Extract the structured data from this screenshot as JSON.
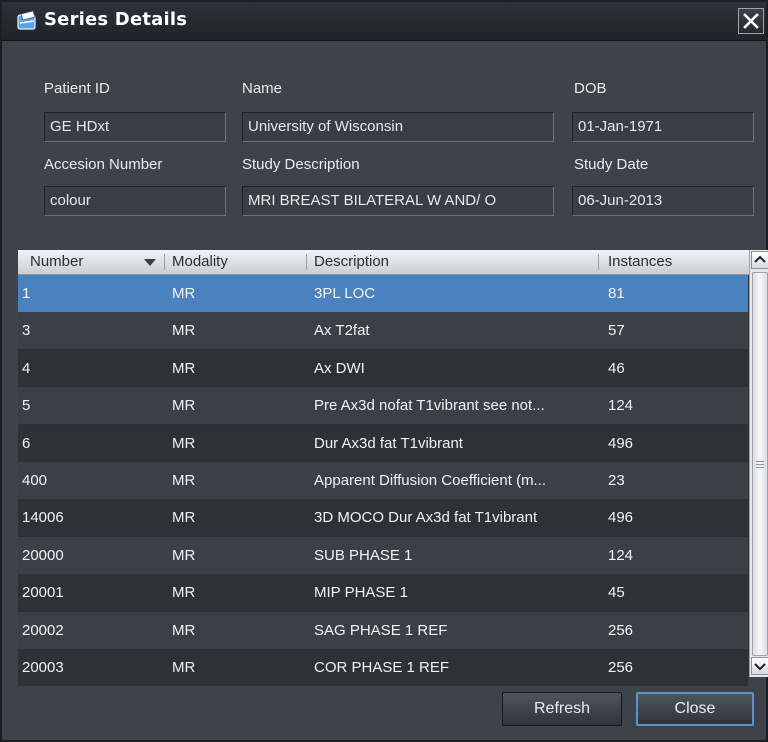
{
  "window": {
    "title": "Series Details",
    "close_glyph": "✕",
    "title_icon": "series-icon"
  },
  "form": {
    "patient_id": {
      "label": "Patient ID",
      "value": "GE HDxt"
    },
    "name": {
      "label": "Name",
      "value": "University of Wisconsin"
    },
    "dob": {
      "label": "DOB",
      "value": "01-Jan-1971"
    },
    "accession": {
      "label": "Accesion Number",
      "value": "colour"
    },
    "study_description": {
      "label": "Study Description",
      "value": "MRI BREAST BILATERAL W AND/ O"
    },
    "study_date": {
      "label": "Study Date",
      "value": "06-Jun-2013"
    }
  },
  "table": {
    "columns": [
      "Number",
      "Modality",
      "Description",
      "Instances"
    ],
    "sort_column": "Number",
    "rows": [
      {
        "number": "1",
        "modality": "MR",
        "description": "3PL LOC",
        "instances": "81",
        "selected": true
      },
      {
        "number": "3",
        "modality": "MR",
        "description": "Ax T2fat",
        "instances": "57"
      },
      {
        "number": "4",
        "modality": "MR",
        "description": "Ax DWI",
        "instances": "46"
      },
      {
        "number": "5",
        "modality": "MR",
        "description": "Pre Ax3d nofat T1vibrant  see not...",
        "instances": "124"
      },
      {
        "number": "6",
        "modality": "MR",
        "description": "Dur Ax3d fat T1vibrant",
        "instances": "496"
      },
      {
        "number": "400",
        "modality": "MR",
        "description": "Apparent Diffusion Coefficient (m...",
        "instances": "23"
      },
      {
        "number": "14006",
        "modality": "MR",
        "description": "3D MOCO Dur Ax3d fat T1vibrant",
        "instances": "496"
      },
      {
        "number": "20000",
        "modality": "MR",
        "description": "SUB PHASE 1",
        "instances": "124"
      },
      {
        "number": "20001",
        "modality": "MR",
        "description": "MIP PHASE 1",
        "instances": "45"
      },
      {
        "number": "20002",
        "modality": "MR",
        "description": "SAG PHASE 1 REF",
        "instances": "256"
      },
      {
        "number": "20003",
        "modality": "MR",
        "description": "COR PHASE 1 REF",
        "instances": "256"
      }
    ]
  },
  "buttons": {
    "refresh": "Refresh",
    "close": "Close"
  },
  "colors": {
    "selected_row": "#4a82bf",
    "window_bg": "#3d4349",
    "default_button_border": "#5b93cf"
  }
}
